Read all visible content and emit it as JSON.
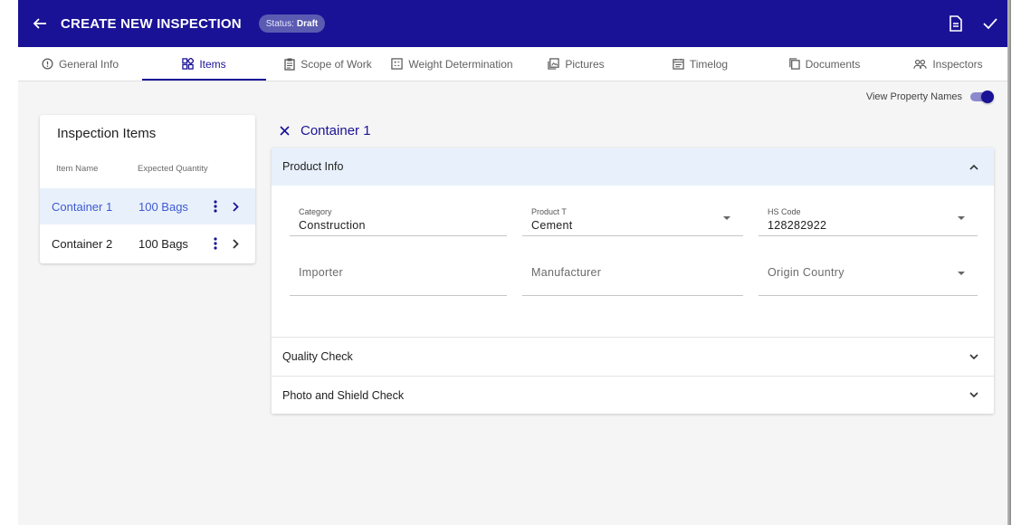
{
  "header": {
    "title": "CREATE NEW INSPECTION",
    "status_label": "Status:",
    "status_value": "Draft",
    "icons": [
      "arrow-back-icon",
      "document-icon",
      "check-icon"
    ]
  },
  "tabs": [
    {
      "label": "General Info",
      "icon": "info-icon"
    },
    {
      "label": "Items",
      "icon": "grid-icon",
      "active": true
    },
    {
      "label": "Scope of Work",
      "icon": "clipboard-icon"
    },
    {
      "label": "Weight Determination",
      "icon": "scale-icon"
    },
    {
      "label": "Pictures",
      "icon": "image-icon"
    },
    {
      "label": "Timelog",
      "icon": "calendar-icon"
    },
    {
      "label": "Documents",
      "icon": "copy-icon"
    },
    {
      "label": "Inspectors",
      "icon": "people-icon"
    }
  ],
  "toggle": {
    "label": "View Property Names",
    "on": true
  },
  "items_panel": {
    "title": "Inspection Items",
    "columns": [
      "Item Name",
      "Expected Quantity"
    ],
    "rows": [
      {
        "name": "Container 1",
        "qty": "100 Bags",
        "selected": true
      },
      {
        "name": "Container 2",
        "qty": "100 Bags",
        "selected": false
      }
    ]
  },
  "detail": {
    "title": "Container 1",
    "sections": {
      "product_info": "Product Info",
      "quality_check": "Quality Check",
      "photo_shield": "Photo and Shield Check"
    },
    "fields": {
      "category": {
        "label": "Category",
        "value": "Construction"
      },
      "product_type": {
        "label": "Product T",
        "value": "Cement"
      },
      "hs_code": {
        "label": "HS Code",
        "value": "128282922"
      },
      "importer": {
        "placeholder": "Importer"
      },
      "manufacturer": {
        "placeholder": "Manufacturer"
      },
      "origin_country": {
        "placeholder": "Origin Country"
      }
    }
  },
  "colors": {
    "primary": "#1a1296",
    "selected_row_bg": "#e8f1fb",
    "selected_row_text": "#3f59d1"
  }
}
